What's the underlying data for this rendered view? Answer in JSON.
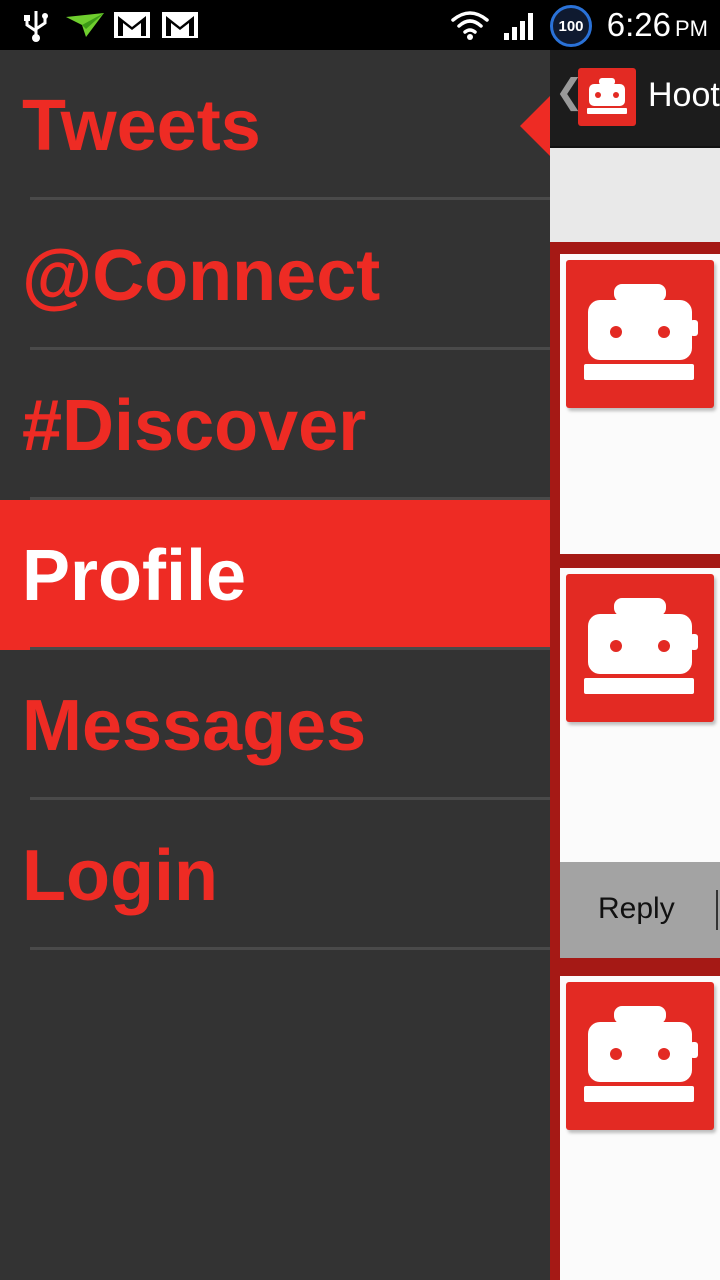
{
  "status_bar": {
    "icons_left": [
      "usb-icon",
      "airdroid-icon",
      "gmail-icon",
      "gmail-icon"
    ],
    "icons_right": [
      "wifi-icon",
      "signal-icon"
    ],
    "battery_level": "100",
    "time": "6:26",
    "ampm": "PM"
  },
  "drawer": {
    "items": [
      {
        "label": "Tweets",
        "active": false
      },
      {
        "label": "@Connect",
        "active": false
      },
      {
        "label": "#Discover",
        "active": false
      },
      {
        "label": "Profile",
        "active": true
      },
      {
        "label": "Messages",
        "active": false
      },
      {
        "label": "Login",
        "active": false
      }
    ]
  },
  "content": {
    "app_title": "Hoot",
    "back_glyph": "❮",
    "reply_label": "Reply"
  },
  "colors": {
    "accent": "#ee2b24",
    "drawer_bg": "#333333",
    "feed_border": "#a51915"
  }
}
